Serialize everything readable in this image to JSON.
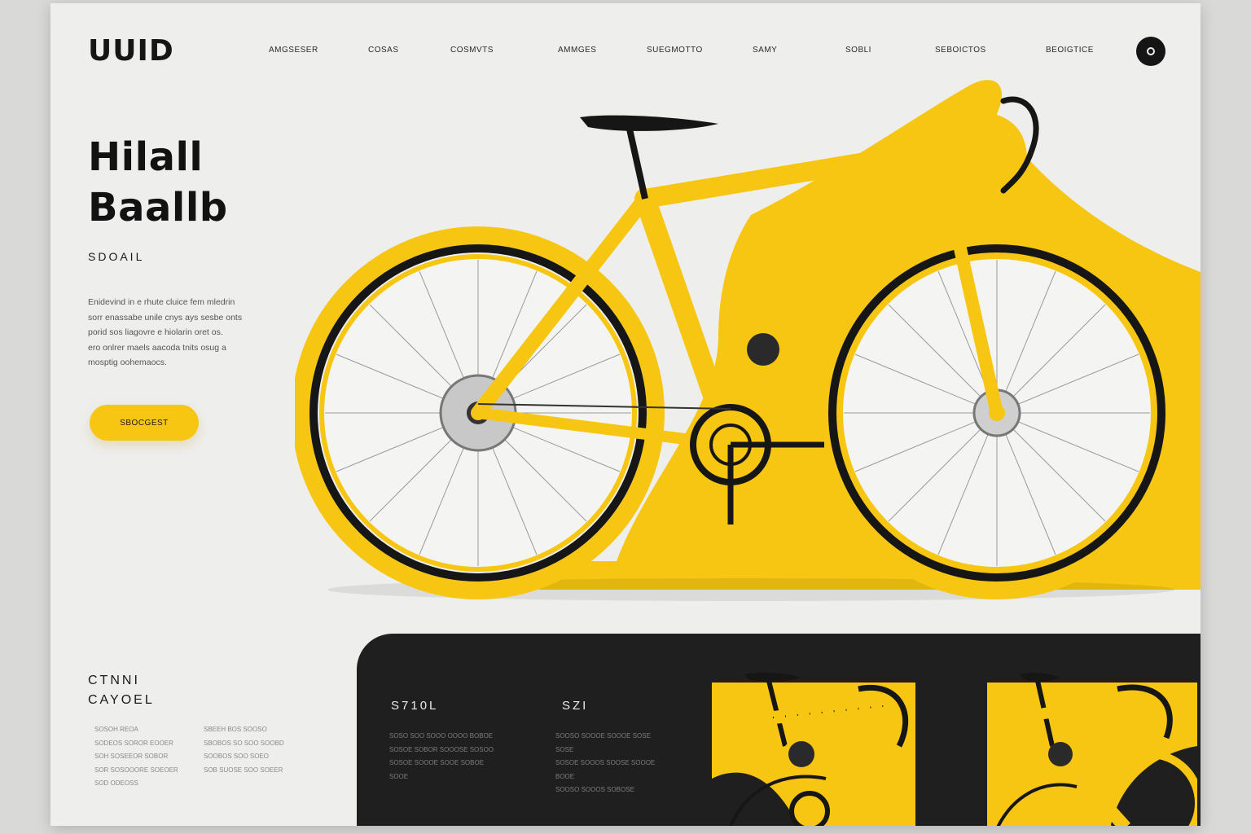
{
  "brand": {
    "logo": "UUID"
  },
  "nav": {
    "items": [
      "AMGSESER",
      "COSAS",
      "COSMVTS",
      "AMMGES",
      "SUEGMOTTO",
      "SAMY",
      "SOBLI",
      "SEBOICTOS",
      "BEOIGTICE"
    ]
  },
  "hero": {
    "title_line1": "Hilall",
    "title_line2": "Baallb",
    "subtitle": "SDOAIL",
    "description": [
      "Enidevind in e rhute cluice fem mledrin",
      "sorr enassabe unile cnys ays sesbe onts",
      "porid sos liagovre e hiolarin oret os.",
      "ero onlrer maels aacoda tnits osug a",
      "mosptig oohemaocs."
    ],
    "cta_label": "SBOCGEST"
  },
  "features": {
    "title_line1": "CTNNI",
    "title_line2": "CAYOEL",
    "col1": [
      "SOSOH REOA",
      "SODEOS SOROR EOOER",
      "SOH SOSEEOR SOBOR",
      "SOR SOSOOORE SOEOER",
      "SOD ODEOSS"
    ],
    "col2": [
      "SBEEH BOS SOOSO",
      "SBOBOS SO SOO SOOBD",
      "SOOBOS SOO SOEO",
      "SOB SUOSE SOO SOEER"
    ]
  },
  "specs": {
    "label_1": "S710L",
    "label_2": "SZI",
    "text_1": [
      "SOSO SOO SOOO OOOO BOBOE",
      "SOSOE SOBOR SOOOSE SOSOO",
      "SOSOE SOOOE SOOE SOBOE SOOE"
    ],
    "text_2": [
      "SOOSO SOOOE SOOOE SOSE SOSE",
      "SOSOE SOOOS SOOSE SOOOE BOOE",
      "SOOSO SOOOS SOBOSE"
    ]
  },
  "colors": {
    "accent": "#f6c612",
    "dark": "#1f1f1f",
    "background": "#eeeeec"
  },
  "icons": {
    "menu": "circle-menu-icon"
  }
}
